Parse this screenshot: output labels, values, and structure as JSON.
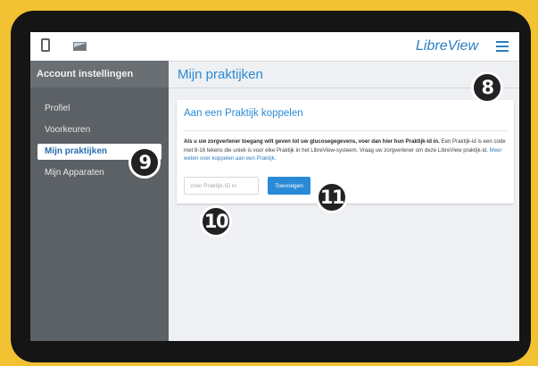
{
  "topbar": {
    "icons": [
      "tablet-device-icon",
      "image-icon",
      "hamburger-menu-icon"
    ],
    "logo": "LibreView"
  },
  "sidebar": {
    "title": "Account instellingen",
    "items": [
      {
        "label": "Profiel",
        "active": false
      },
      {
        "label": "Voorkeuren",
        "active": false
      },
      {
        "label": "Mijn praktijken",
        "active": true
      },
      {
        "label": "Mijn Apparaten",
        "active": false
      }
    ]
  },
  "main": {
    "title": "Mijn praktijken",
    "card": {
      "title": "Aan een Praktijk koppelen",
      "text_bold": "Als u uw zorgverlener toegang wilt geven tot uw glucosegegevens, voer dan hier hun Praktijk-id in.",
      "text_normal": " Een Praktijk-id is een code met 8-16 tekens die uniek is voor elke Praktijk in het LibreView-systeem. Vraag uw zorgverlener om deze LibreView praktijk-id.",
      "link": "Meer weten over koppelen aan een Praktijk.",
      "input_placeholder": "Voer Praktijk-ID in",
      "input_value": "",
      "add_button": "Toevoegen"
    }
  },
  "callouts": [
    "8",
    "9",
    "10",
    "11"
  ],
  "colors": {
    "frame": "#f2c233",
    "tablet": "#151515",
    "accent": "#2a8ad6",
    "sidebar": "#5c6166",
    "badge": "#222222"
  }
}
